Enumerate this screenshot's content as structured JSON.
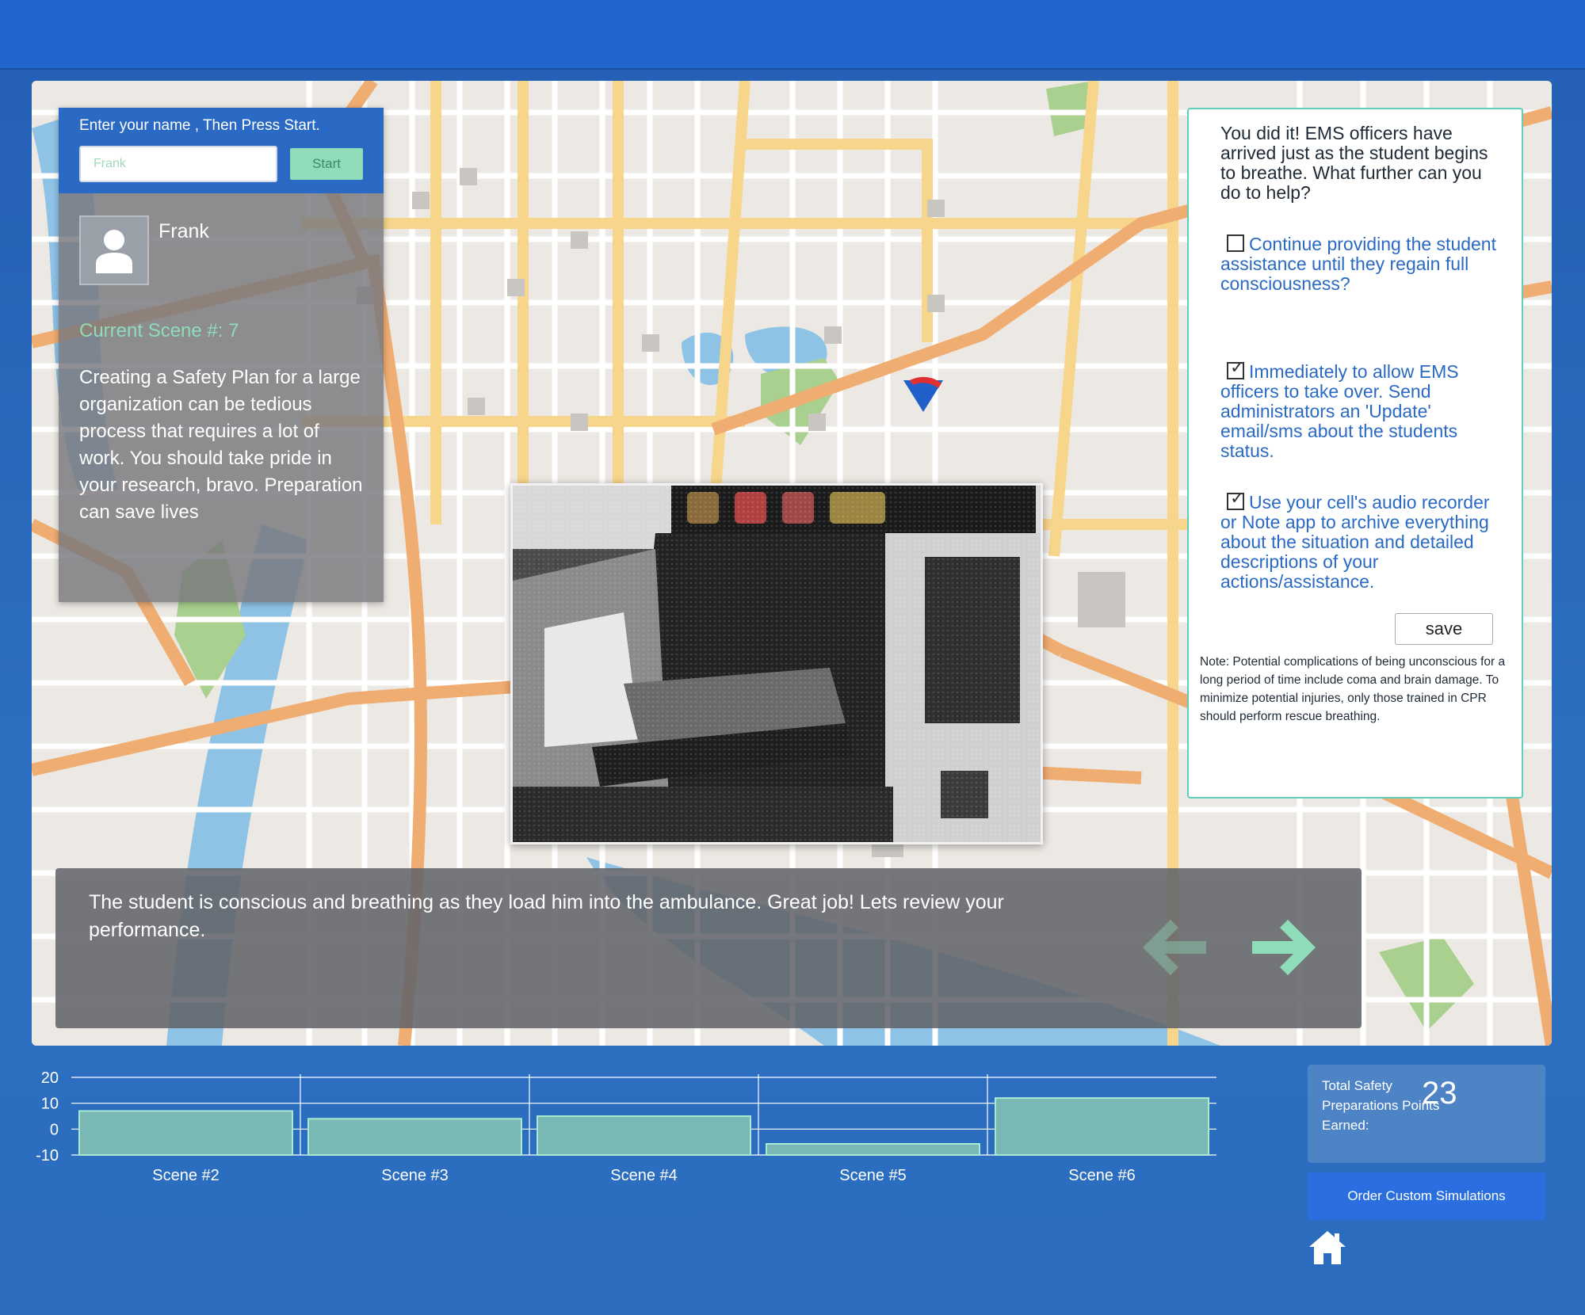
{
  "name_entry": {
    "prompt": "Enter your name , Then Press Start.",
    "placeholder": "Frank",
    "start_label": "Start"
  },
  "profile": {
    "username": "Frank",
    "avatar_icon": "user-silhouette-icon"
  },
  "scene": {
    "current_label": "Current Scene #: 7",
    "description": "Creating a Safety Plan for a large organization can be tedious process that requires a lot of work. You should take pride in your research, bravo. Preparation can save lives"
  },
  "question_panel": {
    "question": "You did it! EMS officers have arrived just as the student begins to breathe. What further can you do to help?",
    "options": [
      {
        "label": "Continue providing the student assistance until they regain full consciousness?",
        "checked": false
      },
      {
        "label": "Immediately to allow EMS officers to take over. Send administrators an 'Update' email/sms about the students status.",
        "checked": true
      },
      {
        "label": "Use your cell's audio recorder or Note app to archive everything about the situation and detailed descriptions of your actions/assistance.",
        "checked": true
      }
    ],
    "save_label": "save",
    "note": "Note: Potential complications of being unconscious for a long period of time include coma and brain damage. To minimize potential injuries, only those trained in CPR should perform rescue breathing."
  },
  "message": {
    "text": "The student is conscious and breathing as they load him into the ambulance. Great job! Lets review your performance.",
    "prev_icon": "arrow-left-icon",
    "next_icon": "arrow-right-icon"
  },
  "score": {
    "label": "Total Safety Preparations Points Earned:",
    "value": "23"
  },
  "order_button_label": "Order Custom Simulations",
  "home_icon": "home-icon",
  "colors": {
    "accent_green": "#8fdcb8",
    "brand_blue": "#2066cc",
    "link_blue": "#2a6ac4"
  },
  "chart_data": {
    "type": "bar",
    "categories": [
      "Scene #2",
      "Scene #3",
      "Scene #4",
      "Scene #5",
      "Scene #6"
    ],
    "values": [
      7,
      4,
      5,
      -3,
      12
    ],
    "ylim": [
      -10,
      20
    ],
    "yticks": [
      20,
      10,
      0,
      -10
    ],
    "grid": true
  }
}
